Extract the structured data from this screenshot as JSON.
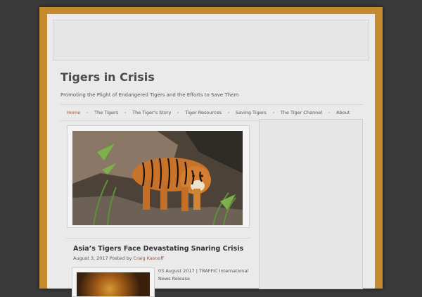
{
  "site": {
    "title": "Tigers in Crisis",
    "tagline": "Promoting the Plight of Endangered Tigers and the Efforts to Save Them"
  },
  "nav": {
    "items": [
      {
        "label": "Home",
        "active": true
      },
      {
        "label": "The Tigers",
        "active": false
      },
      {
        "label": "The Tiger’s Story",
        "active": false
      },
      {
        "label": "Tiger Resources",
        "active": false
      },
      {
        "label": "Saving Tigers",
        "active": false
      },
      {
        "label": "The Tiger Channel",
        "active": false
      },
      {
        "label": "About",
        "active": false
      }
    ]
  },
  "post": {
    "title": "Asia’s Tigers Face Devastating Snaring Crisis",
    "date": "August 3, 2017",
    "posted_by": "Posted by",
    "author": "Craig Kasnoff",
    "excerpt": "03 August 2017 | TRAFFIC International News Release"
  },
  "colors": {
    "background": "#3a3a3a",
    "frame": "#c58a2d",
    "paper": "#ececec",
    "accent": "#b3462b",
    "title": "#4b4b4b"
  }
}
